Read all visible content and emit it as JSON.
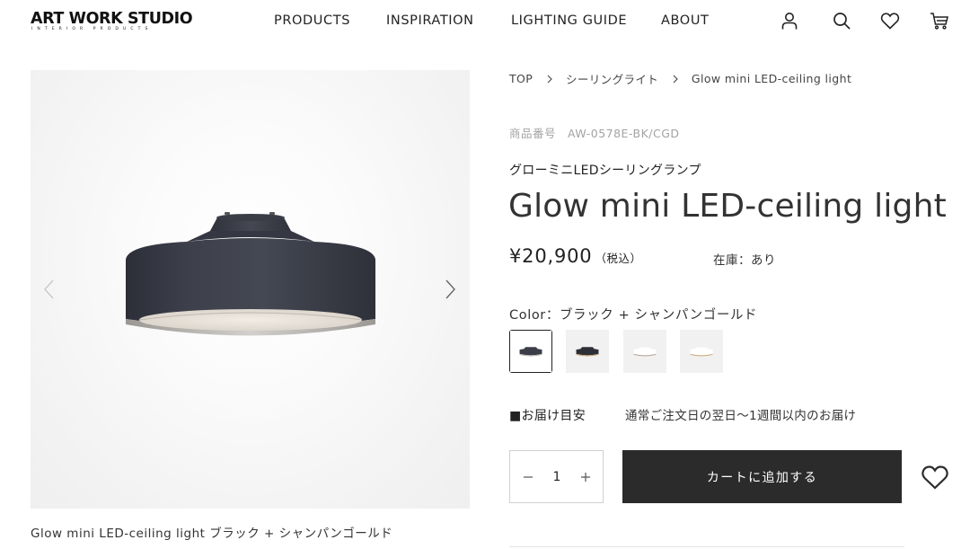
{
  "brand": {
    "name": "ART WORK STUDIO",
    "tagline": "INTERIOR PRODUCTS"
  },
  "nav": [
    {
      "label": "PRODUCTS"
    },
    {
      "label": "INSPIRATION"
    },
    {
      "label": "LIGHTING GUIDE"
    },
    {
      "label": "ABOUT"
    }
  ],
  "header_icons": [
    "user-icon",
    "search-icon",
    "heart-icon",
    "cart-icon"
  ],
  "breadcrumb": [
    "TOP",
    "シーリングライト",
    "Glow mini LED-ceiling light"
  ],
  "product": {
    "sku_label": "商品番号",
    "sku": "AW-0578E-BK/CGD",
    "name_jp": "グローミニLEDシーリングランプ",
    "title": "Glow mini LED-ceiling light",
    "price": "¥20,900",
    "tax_note": "（税込）",
    "stock": "在庫：あり",
    "color_label": "Color：ブラック + シャンパンゴールド",
    "swatches": [
      {
        "variant": "black-silver",
        "selected": true
      },
      {
        "variant": "black-gold",
        "selected": false
      },
      {
        "variant": "white-silver",
        "selected": false
      },
      {
        "variant": "white-wood",
        "selected": false
      }
    ],
    "delivery_label": "■お届け目安",
    "delivery_value": "通常ご注文日の翌日〜1週間以内のお届け",
    "quantity": "1",
    "add_to_cart": "カートに追加する"
  },
  "gallery": {
    "caption": "Glow mini LED-ceiling light ブラック + シャンパンゴールド"
  },
  "colors": {
    "primary": "#2b2b2b",
    "lamp_body": "#3b3e48",
    "lamp_rim": "#b8b5b0",
    "muted_text": "#a3a3a3",
    "gallery_bg": "#f4f4f4"
  }
}
